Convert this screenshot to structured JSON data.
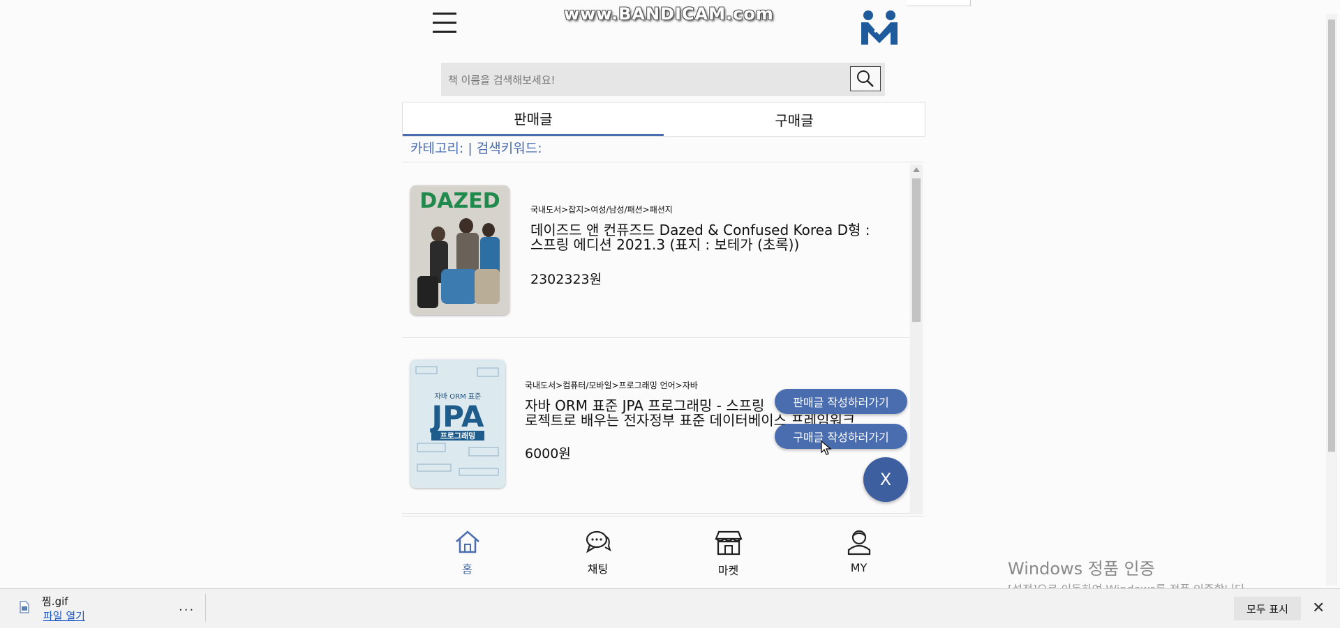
{
  "recorder_watermark": "www.BANDICAM.com",
  "header": {
    "menu_icon": "hamburger-icon",
    "logo_icon": "app-logo-icon"
  },
  "search": {
    "placeholder": "책 이름을 검색해보세요!",
    "value": ""
  },
  "tabs": [
    {
      "label": "판매글",
      "active": true
    },
    {
      "label": "구매글",
      "active": false
    }
  ],
  "filter": {
    "text": "카테고리: | 검색키워드:"
  },
  "listings": [
    {
      "category_path": "국내도서>잡지>여성/남성/패션>패션지",
      "title_line1": "데이즈드 앤 컨퓨즈드 Dazed & Confused Korea D형 :",
      "title_line2": "스프링 에디션 2021.3 (표지 : 보테가 (초록))",
      "price": "2302323원",
      "cover_text": "DAZED"
    },
    {
      "category_path": "국내도서>컴퓨터/모바일>프로그래밍 언어>자바",
      "title_line1": "자바 ORM 표준 JPA 프로그래밍 - 스프링",
      "title_line2": "로젝트로 배우는 전자정부 표준 데이터베이스 프레임워크",
      "price": "6000원",
      "cover_text": "JPA",
      "cover_subtitle": "프로그래밍",
      "cover_top": "자바 ORM 표준"
    }
  ],
  "fab": {
    "write_sell": "판매글 작성하러가기",
    "write_buy": "구매글 작성하러가기",
    "close": "X"
  },
  "bottom_nav": [
    {
      "label": "홈",
      "icon": "home-icon",
      "active": true
    },
    {
      "label": "채팅",
      "icon": "chat-icon",
      "active": false
    },
    {
      "label": "마켓",
      "icon": "store-icon",
      "active": false
    },
    {
      "label": "MY",
      "icon": "user-icon",
      "active": false
    }
  ],
  "windows_activation": {
    "title": "Windows 정품 인증",
    "subtitle": "[설정]으로 이동하여 Windows를 정품 인증합니다."
  },
  "download_bar": {
    "file_name": "찜.gif",
    "open_label": "파일 열기",
    "more": "...",
    "show_all": "모두 표시",
    "close": "✕"
  },
  "colors": {
    "accent": "#4a6db0",
    "fab_close": "#3e5f9f"
  }
}
